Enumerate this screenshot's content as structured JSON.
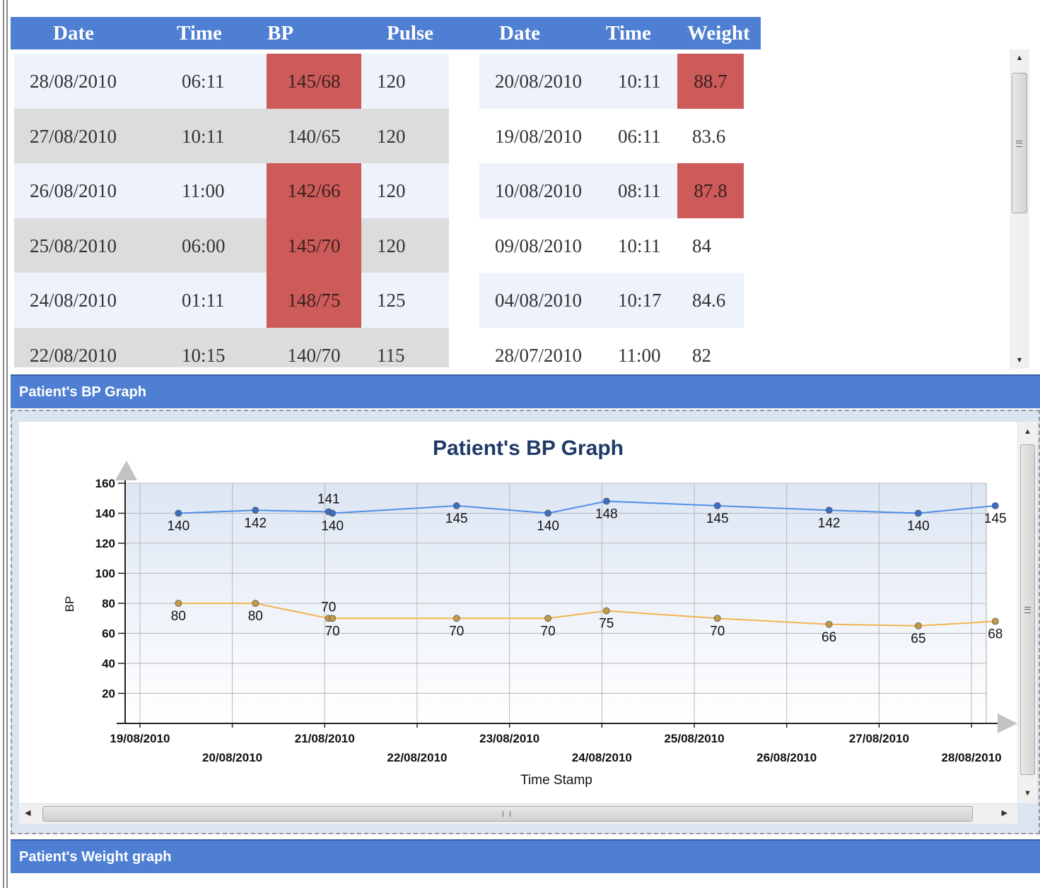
{
  "bp_table": {
    "headers": [
      "Date",
      "Time",
      "BP",
      "Pulse"
    ],
    "rows": [
      {
        "date": "28/08/2010",
        "time": "06:11",
        "bp": "145/68",
        "pulse": "120",
        "highlight": true
      },
      {
        "date": "27/08/2010",
        "time": "10:11",
        "bp": "140/65",
        "pulse": "120",
        "highlight": false
      },
      {
        "date": "26/08/2010",
        "time": "11:00",
        "bp": "142/66",
        "pulse": "120",
        "highlight": true
      },
      {
        "date": "25/08/2010",
        "time": "06:00",
        "bp": "145/70",
        "pulse": "120",
        "highlight": true
      },
      {
        "date": "24/08/2010",
        "time": "01:11",
        "bp": "148/75",
        "pulse": "125",
        "highlight": true
      },
      {
        "date": "22/08/2010",
        "time": "10:15",
        "bp": "140/70",
        "pulse": "115",
        "highlight": false
      }
    ]
  },
  "weight_table": {
    "headers": [
      "Date",
      "Time",
      "Weight"
    ],
    "rows": [
      {
        "date": "20/08/2010",
        "time": "10:11",
        "weight": "88.7",
        "highlight": true
      },
      {
        "date": "19/08/2010",
        "time": "06:11",
        "weight": "83.6",
        "highlight": false
      },
      {
        "date": "10/08/2010",
        "time": "08:11",
        "weight": "87.8",
        "highlight": true
      },
      {
        "date": "09/08/2010",
        "time": "10:11",
        "weight": "84",
        "highlight": false
      },
      {
        "date": "04/08/2010",
        "time": "10:17",
        "weight": "84.6",
        "highlight": false
      },
      {
        "date": "28/07/2010",
        "time": "11:00",
        "weight": "82",
        "highlight": false
      }
    ]
  },
  "colors": {
    "header_blue": "#4f7fd3",
    "alert_red": "#cd5b59",
    "row_light": "#edf2fb",
    "row_gray": "#dcdcdc",
    "systolic_line": "#4f8fe8",
    "diastolic_line": "#f4b350"
  },
  "sections": {
    "bp_graph": "Patient's BP Graph",
    "weight_graph": "Patient's Weight graph"
  },
  "icons": {
    "scroll_up": "triangle-up-icon",
    "scroll_down": "triangle-down-icon",
    "scroll_left": "triangle-left-icon",
    "scroll_right": "triangle-right-icon"
  },
  "chart_data": {
    "type": "line",
    "title": "Patient's BP Graph",
    "xlabel": "Time Stamp",
    "ylabel": "BP",
    "ylim": [
      0,
      160
    ],
    "yticks": [
      20,
      40,
      60,
      80,
      100,
      120,
      140,
      160
    ],
    "xticks": [
      "19/08/2010",
      "20/08/2010",
      "21/08/2010",
      "22/08/2010",
      "23/08/2010",
      "24/08/2010",
      "25/08/2010",
      "26/08/2010",
      "27/08/2010",
      "28/08/2010"
    ],
    "x": [
      "19/08/2010 10:00",
      "20/08/2010 06:00",
      "21/08/2010 01:00",
      "21/08/2010 02:00",
      "22/08/2010 10:15",
      "23/08/2010 10:00",
      "24/08/2010 01:11",
      "25/08/2010 06:00",
      "26/08/2010 11:00",
      "27/08/2010 10:11",
      "28/08/2010 06:11"
    ],
    "series": [
      {
        "values": [
          140,
          142,
          141,
          140,
          145,
          140,
          148,
          145,
          142,
          140,
          145
        ],
        "color": "#4f8fe8"
      },
      {
        "values": [
          80,
          80,
          70,
          70,
          70,
          70,
          75,
          70,
          66,
          65,
          68
        ],
        "color": "#f4b350"
      }
    ],
    "data_labels": {
      "systolic": [
        "140",
        "142",
        "141",
        "140",
        "145",
        "140",
        "148",
        "145",
        "142",
        "140",
        "145"
      ],
      "diastolic": [
        "80",
        "80",
        "70",
        "70",
        "70",
        "70",
        "75",
        "70",
        "66",
        "65",
        "68"
      ]
    },
    "grid": true
  }
}
